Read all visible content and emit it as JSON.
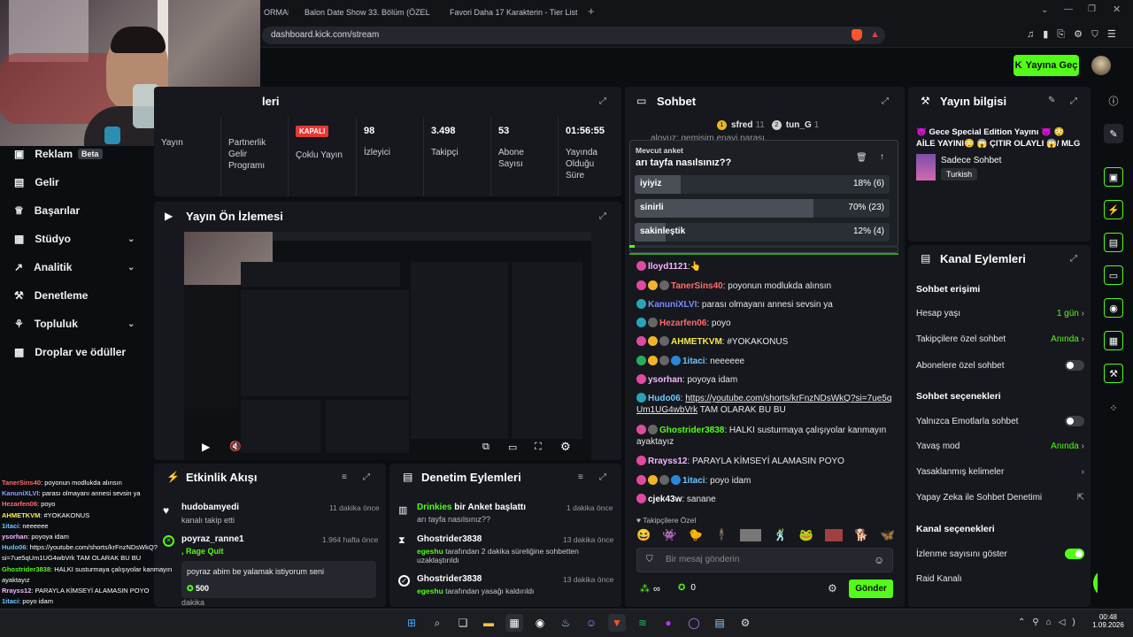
{
  "browser": {
    "tabs": [
      "ORMAN",
      "Balon Date Show 33. Bölüm (ÖZEL E",
      "Favori Daha 17 Karakterin - Tier List |"
    ],
    "new_tab": "+",
    "url": "dashboard.kick.com/stream"
  },
  "header": {
    "go_live": "Yayına Geç"
  },
  "sidebar": {
    "items": [
      {
        "label": "Reklam",
        "badge": "Beta"
      },
      {
        "label": "Gelir"
      },
      {
        "label": "Başarılar"
      },
      {
        "label": "Stüdyo"
      },
      {
        "label": "Analitik"
      },
      {
        "label": "Denetleme"
      },
      {
        "label": "Topluluk"
      },
      {
        "label": "Droplar ve ödüller"
      }
    ]
  },
  "stats_panel": {
    "title_partial": "leri",
    "stats": [
      {
        "value": "",
        "label": "Yayın"
      },
      {
        "value": "",
        "label": "Partnerlik Gelir Programı"
      },
      {
        "value": "KAPALI",
        "label": "Çoklu Yayın"
      },
      {
        "value": "98",
        "label": "İzleyici"
      },
      {
        "value": "3.498",
        "label": "Takipçi"
      },
      {
        "value": "53",
        "label": "Abone Sayısı"
      },
      {
        "value": "01:56:55",
        "label": "Yayında Olduğu Süre"
      }
    ]
  },
  "preview": {
    "title": "Yayın Ön İzlemesi"
  },
  "activity": {
    "title": "Etkinlik Akışı",
    "items": [
      {
        "user": "hudobamyedi",
        "text": "kanalı takip etti",
        "time": "11 dakika önce"
      },
      {
        "user": "poyraz_ranne1",
        "text": ", Rage Quit",
        "time": "1.964 hafta önce",
        "quote": "poyraz abim be yalamak istiyorum seni",
        "amount": "500",
        "extra": "dakika"
      }
    ]
  },
  "moderation": {
    "title": "Denetim Eylemleri",
    "items": [
      {
        "user": "Drinkies",
        "action": "bir Anket başlattı",
        "detail": "arı tayfa nasılsınız??",
        "time": "1 dakika önce"
      },
      {
        "user": "Ghostrider3838",
        "actor": "egeshu",
        "action": "tarafından 2 dakika süreliğine sohbetten uzaklaştırıldı",
        "time": "13 dakika önce"
      },
      {
        "user": "Ghostrider3838",
        "actor": "egeshu",
        "action": "tarafından yasağı kaldırıldı",
        "time": "13 dakika önce"
      }
    ]
  },
  "chat": {
    "title": "Sohbet",
    "gifters": [
      {
        "name": "sfred",
        "count": "11"
      },
      {
        "name": "tun_G",
        "count": "1"
      }
    ],
    "top_line": "aloyuz: gemişim enayi parası",
    "poll": {
      "label": "Mevcut anket",
      "question": "arı tayfa nasılsınız??",
      "options": [
        {
          "text": "iyiyiz",
          "result": "18% (6)",
          "fraction": 0.18
        },
        {
          "text": "sinirli",
          "result": "70% (23)",
          "fraction": 0.7
        },
        {
          "text": "sakinleştik",
          "result": "12% (4)",
          "fraction": 0.12
        }
      ]
    },
    "messages": [
      {
        "user": "lloyd1121",
        "text": ":👆",
        "color": "#f5b7ff"
      },
      {
        "user": "TanerSins40",
        "text": ": poyonun modlukda alınsın",
        "color": "#ff6b6b"
      },
      {
        "user": "KanuniXLVI",
        "text": ": parası olmayanı annesi sevsin ya",
        "color": "#7b8cff"
      },
      {
        "user": "Hezarfen06",
        "text": ": poyo",
        "color": "#ff6b6b"
      },
      {
        "user": "AHMETKVM",
        "text": ": #YOKAKONUS",
        "color": "#f7e94d"
      },
      {
        "user": "1itaci",
        "text": ": neeeeee",
        "color": "#6ec6ff"
      },
      {
        "user": "ysorhan",
        "text": ": poyoya idam",
        "color": "#f5b7ff"
      },
      {
        "user": "Hudo06",
        "text": ": ",
        "link": "https://youtube.com/shorts/krFnzNDsWkQ?si=7ue5qUm1UG4wbVrk",
        "after": " TAM OLARAK BU BU",
        "color": "#6ec6ff"
      },
      {
        "user": "Ghostrider3838",
        "text": ": HALKI susturmaya çalışıyolar kanmayın ayaktayız",
        "color": "#53fc18"
      },
      {
        "user": "Rrayss12",
        "text": ": PARAYLA KİMSEYİ ALAMASIN POYO",
        "color": "#f5b7ff"
      },
      {
        "user": "1itaci",
        "text": ": poyo idam",
        "color": "#6ec6ff"
      },
      {
        "user": "cjek43w",
        "text": ": sanane",
        "color": "#ffffff"
      }
    ],
    "followers_only": "Takipçilere Özel",
    "input_placeholder": "Bir mesaj gönderin",
    "counters": {
      "infinity": "∞",
      "zero": "0"
    },
    "send": "Gönder"
  },
  "stream_info": {
    "title": "Yayın bilgisi",
    "stream_title": "😈 Gece Special Edition Yayını 😈 😳 AİLE YAYINI😳 😱 ÇITIR OLAYLI 😱/ MLG !...",
    "category": "Sadece Sohbet",
    "language": "Turkish"
  },
  "channel_actions": {
    "title": "Kanal Eylemleri",
    "chat_access": "Sohbet erişimi",
    "account_age": {
      "label": "Hesap yaşı",
      "value": "1 gün"
    },
    "followers_chat": {
      "label": "Takipçilere özel sohbet",
      "value": "Anında"
    },
    "subs_chat": {
      "label": "Abonelere özel sohbet"
    },
    "chat_options": "Sohbet seçenekleri",
    "emote_only": {
      "label": "Yalnızca Emotlarla sohbet"
    },
    "slow_mode": {
      "label": "Yavaş mod",
      "value": "Anında"
    },
    "banned_words": {
      "label": "Yasaklanmış kelimeler"
    },
    "ai_mod": {
      "label": "Yapay Zeka ile Sohbet Denetimi"
    },
    "channel_options": "Kanal seçenekleri",
    "show_views": {
      "label": "İzlenme sayısını göster"
    },
    "raid": {
      "label": "Raid Kanalı"
    }
  },
  "overlay_chat": [
    {
      "user": "TanerSins40",
      "text": ": poyonun modlukda alınsın",
      "color": "#ff6b6b"
    },
    {
      "user": "KanuniXLVI",
      "text": ": parası olmayanı annesi sevsin ya",
      "color": "#8fa0ff"
    },
    {
      "user": "Hezarfen06",
      "text": ": poyo",
      "color": "#ff6b6b"
    },
    {
      "user": "AHMETKVM",
      "text": ": #YOKAKONUS",
      "color": "#f7e94d"
    },
    {
      "user": "1itaci",
      "text": ": neeeeee",
      "color": "#6ec6ff"
    },
    {
      "user": "ysorhan",
      "text": ": poyoya idam",
      "color": "#f5b7ff"
    },
    {
      "user": "Hudo06",
      "text": ": https://youtube.com/shorts/krFnzNDsWkQ?",
      "color": "#6ec6ff"
    },
    {
      "user": "",
      "text": "si=7ue5qUm1UG4wbVrk TAM OLARAK BU BU",
      "color": "#ffffff"
    },
    {
      "user": "Ghostrider3838",
      "text": ": HALKI susturmaya çalışıyolar kanmayın",
      "color": "#53fc18"
    },
    {
      "user": "",
      "text": "ayaktayız",
      "color": "#ffffff"
    },
    {
      "user": "Rrayss12",
      "text": ": PARAYLA KİMSEYİ ALAMASIN POYO",
      "color": "#f5b7ff"
    },
    {
      "user": "1itaci",
      "text": ": poyo idam",
      "color": "#6ec6ff"
    },
    {
      "user": "cjek43w",
      "text": ": sanane",
      "color": "#ffffff"
    }
  ],
  "taskbar": {
    "time": "00:48",
    "date": "1.09.2026"
  }
}
